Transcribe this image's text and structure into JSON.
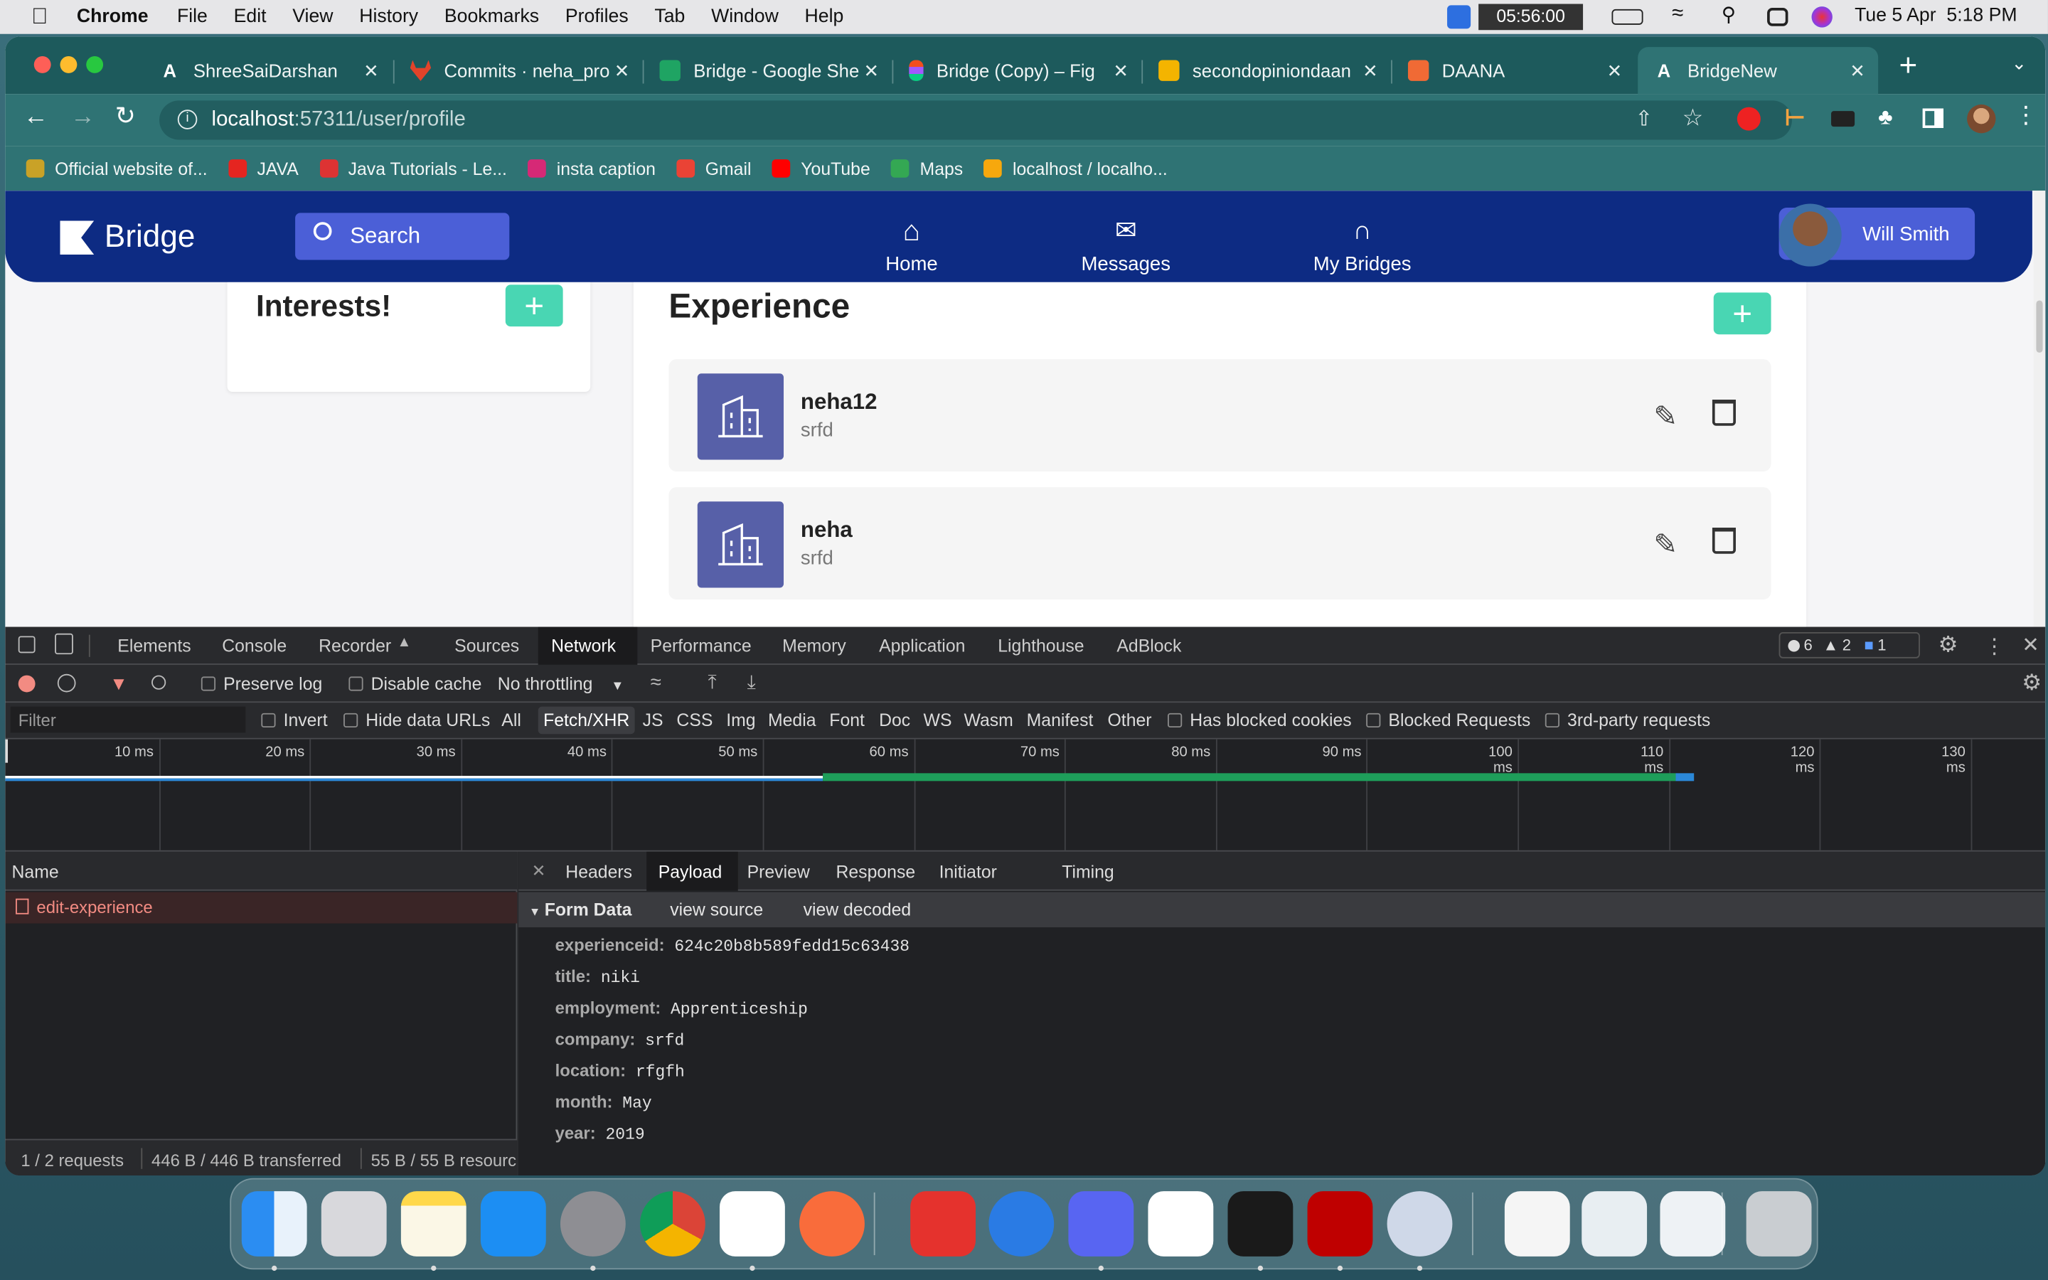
{
  "menubar": {
    "app": "Chrome",
    "menus": [
      "File",
      "Edit",
      "View",
      "History",
      "Bookmarks",
      "Profiles",
      "Tab",
      "Window",
      "Help"
    ],
    "timer": "05:56:00",
    "datetime": "Tue 5 Apr  5:18 PM"
  },
  "tabs": [
    {
      "title": "ShreeSaiDarshan",
      "color": "#ffffff"
    },
    {
      "title": "Commits · neha_pro",
      "color": "#e2432a"
    },
    {
      "title": "Bridge - Google She",
      "color": "#1fa463"
    },
    {
      "title": "Bridge (Copy) – Fig",
      "color": "#f24e1e"
    },
    {
      "title": "secondopiniondaan",
      "color": "#f4b400"
    },
    {
      "title": "DAANA",
      "color": "#f06a35"
    },
    {
      "title": "BridgeNew",
      "color": "#ffffff"
    }
  ],
  "url": {
    "host": "localhost",
    "rest": ":57311/user/profile"
  },
  "bookmarks": [
    {
      "label": "Official website of...",
      "color": "#c9a227"
    },
    {
      "label": "JAVA",
      "color": "#e52520"
    },
    {
      "label": "Java Tutorials - Le...",
      "color": "#d33"
    },
    {
      "label": "insta caption",
      "color": "#d62976"
    },
    {
      "label": "Gmail",
      "color": "#ea4335"
    },
    {
      "label": "YouTube",
      "color": "#ff0000"
    },
    {
      "label": "Maps",
      "color": "#34a853"
    },
    {
      "label": "localhost / localho...",
      "color": "#f7a80d"
    }
  ],
  "app": {
    "brand": "Bridge",
    "search_placeholder": "Search",
    "nav": [
      "Home",
      "Messages",
      "My Bridges"
    ],
    "user": "Will Smith",
    "interests_title": "Interests!",
    "experience_title": "Experience",
    "add_symbol": "+",
    "experiences": [
      {
        "title": "neha12",
        "company": "srfd"
      },
      {
        "title": "neha",
        "company": "srfd"
      }
    ]
  },
  "devtools": {
    "tabs": [
      "Elements",
      "Console",
      "Recorder",
      "Sources",
      "Network",
      "Performance",
      "Memory",
      "Application",
      "Lighthouse",
      "AdBlock"
    ],
    "active_tab": "Network",
    "badges": {
      "errors": "6",
      "warnings": "2",
      "info": "1"
    },
    "toolbar": {
      "preserve_log": "Preserve log",
      "disable_cache": "Disable cache",
      "throttling": "No throttling"
    },
    "filter": {
      "placeholder": "Filter",
      "invert": "Invert",
      "hide_data_urls": "Hide data URLs",
      "types": [
        "All",
        "Fetch/XHR",
        "JS",
        "CSS",
        "Img",
        "Media",
        "Font",
        "Doc",
        "WS",
        "Wasm",
        "Manifest",
        "Other"
      ],
      "active_type": "Fetch/XHR",
      "has_blocked_cookies": "Has blocked cookies",
      "blocked_requests": "Blocked Requests",
      "third_party": "3rd-party requests"
    },
    "timeline_ticks": [
      "10 ms",
      "20 ms",
      "30 ms",
      "40 ms",
      "50 ms",
      "60 ms",
      "70 ms",
      "80 ms",
      "90 ms",
      "100 ms",
      "110 ms",
      "120 ms",
      "130 ms"
    ],
    "timeline_bar": {
      "waiting_end_ms": 54,
      "download_end_ms": 110.5
    },
    "name_header": "Name",
    "requests": [
      "edit-experience"
    ],
    "detail_tabs": [
      "Headers",
      "Payload",
      "Preview",
      "Response",
      "Initiator",
      "Timing"
    ],
    "active_detail_tab": "Payload",
    "form_data": {
      "label": "Form Data",
      "view_source": "view source",
      "view_decoded": "view decoded"
    },
    "payload": [
      {
        "key": "experienceid:",
        "value": "624c20b8b589fedd15c63438"
      },
      {
        "key": "title:",
        "value": "niki"
      },
      {
        "key": "employment:",
        "value": "Apprenticeship"
      },
      {
        "key": "company:",
        "value": "srfd"
      },
      {
        "key": "location:",
        "value": "rfgfh"
      },
      {
        "key": "month:",
        "value": "May"
      },
      {
        "key": "year:",
        "value": "2019"
      }
    ],
    "status": {
      "requests": "1 / 2 requests",
      "transferred": "446 B / 446 B transferred",
      "resources": "55 B / 55 B resourc"
    }
  },
  "dock": [
    "finder-icon",
    "launchpad-icon",
    "notes-icon",
    "app-store-icon",
    "system-preferences-icon",
    "chrome-icon",
    "vscode-icon",
    "postman-icon",
    "anydesk-icon",
    "cloud-icon",
    "discord-icon",
    "slack-icon",
    "terminal-icon",
    "filezilla-icon",
    "settings-icon",
    "document-icon",
    "window-icon",
    "screen-icon",
    "trash-icon"
  ]
}
